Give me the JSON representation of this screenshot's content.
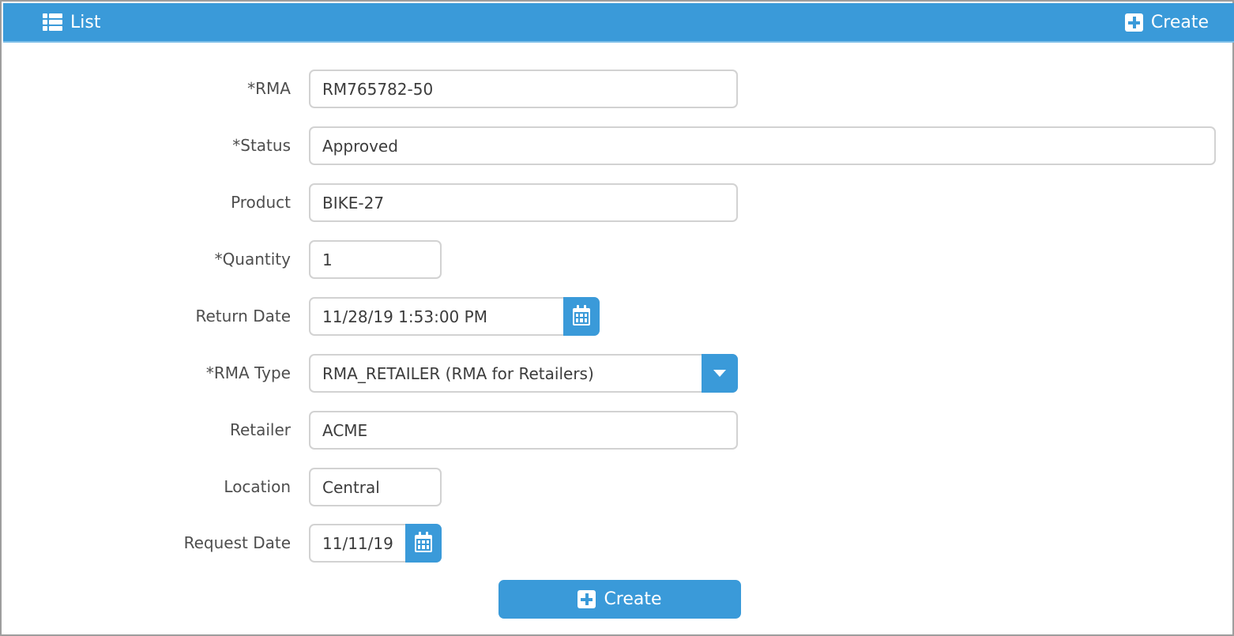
{
  "toolbar": {
    "list_label": "List",
    "create_label": "Create"
  },
  "form": {
    "rma": {
      "label": "*RMA",
      "value": "RM765782-50"
    },
    "status": {
      "label": "*Status",
      "value": "Approved"
    },
    "product": {
      "label": "Product",
      "value": "BIKE-27"
    },
    "quantity": {
      "label": "*Quantity",
      "value": "1"
    },
    "return_date": {
      "label": "Return Date",
      "value": "11/28/19 1:53:00 PM"
    },
    "rma_type": {
      "label": "*RMA Type",
      "value": "RMA_RETAILER (RMA for Retailers)"
    },
    "retailer": {
      "label": "Retailer",
      "value": "ACME"
    },
    "location": {
      "label": "Location",
      "value": "Central"
    },
    "request_date": {
      "label": "Request Date",
      "value": "11/11/19"
    }
  },
  "submit": {
    "label": "Create"
  },
  "colors": {
    "accent": "#3a9ad9",
    "border": "#d2d2d2",
    "label_text": "#4e4e4e",
    "value_text": "#3c3c3c"
  },
  "icons": {
    "list": "list-icon",
    "create": "plus-square-icon",
    "calendar": "calendar-icon",
    "dropdown": "caret-down-icon"
  }
}
